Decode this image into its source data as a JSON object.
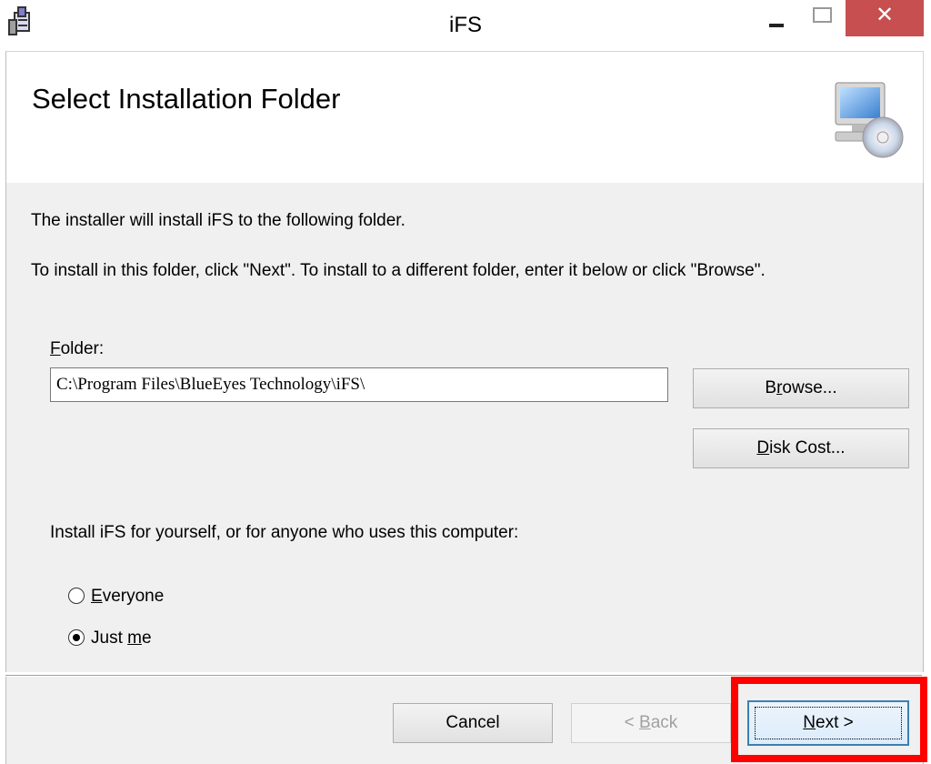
{
  "window": {
    "title": "iFS",
    "app_icon": "installer-icon",
    "controls": [
      "minimize-icon",
      "maximize-icon",
      "close-icon"
    ],
    "close_glyph": "✕"
  },
  "header": {
    "title": "Select Installation Folder",
    "icon": "computer-cd-icon"
  },
  "main": {
    "intro_line1": "The installer will install iFS to the following folder.",
    "intro_line2": "To install in this folder, click \"Next\". To install to a different folder, enter it below or click \"Browse\".",
    "folder_label_mnemonic": "F",
    "folder_label_rest": "older:",
    "folder_value": "C:\\Program Files\\BlueEyes Technology\\iFS\\",
    "browse_mnemonic": "r",
    "browse_pre": "B",
    "browse_post": "owse...",
    "disk_cost_mnemonic": "D",
    "disk_cost_rest": "isk Cost...",
    "scope_prompt": "Install iFS for yourself, or for anyone who uses this computer:",
    "options": [
      {
        "mnemonic": "E",
        "rest": "veryone",
        "selected": false
      },
      {
        "pre": "Just ",
        "mnemonic": "m",
        "rest": "e",
        "selected": true
      }
    ]
  },
  "footer": {
    "cancel_label": "Cancel",
    "back_pre": "< ",
    "back_mnemonic": "B",
    "back_rest": "ack",
    "back_enabled": false,
    "next_mnemonic": "N",
    "next_rest": "ext >",
    "highlight_color": "#ff0000"
  }
}
